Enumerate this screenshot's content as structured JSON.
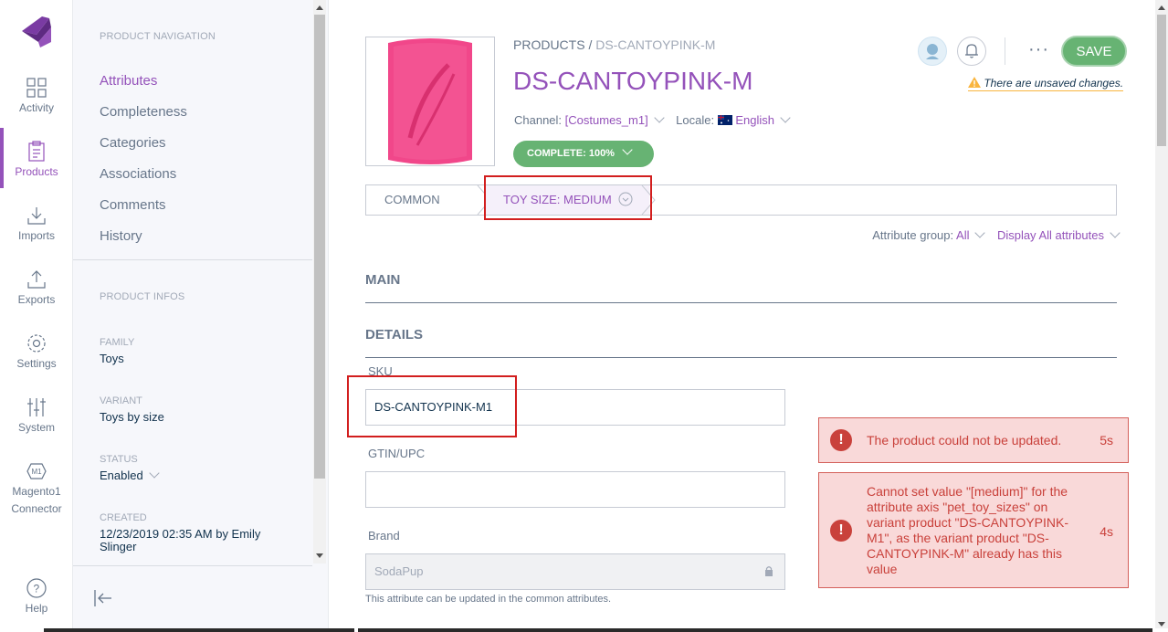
{
  "main_nav": {
    "items": [
      {
        "label": "Activity",
        "icon": "dashboard-grid-icon",
        "active": false
      },
      {
        "label": "Products",
        "icon": "clipboard-icon",
        "active": true
      },
      {
        "label": "Imports",
        "icon": "import-icon",
        "active": false
      },
      {
        "label": "Exports",
        "icon": "export-icon",
        "active": false
      },
      {
        "label": "Settings",
        "icon": "gear-icon",
        "active": false
      },
      {
        "label": "System",
        "icon": "sliders-icon",
        "active": false
      },
      {
        "label": "Magento1",
        "label2": "Connector",
        "icon": "magento-connector-icon",
        "active": false
      }
    ],
    "help": {
      "label": "Help",
      "icon": "help-icon"
    }
  },
  "sub_nav": {
    "nav_title": "PRODUCT NAVIGATION",
    "links": [
      {
        "label": "Attributes",
        "active": true
      },
      {
        "label": "Completeness",
        "active": false
      },
      {
        "label": "Categories",
        "active": false
      },
      {
        "label": "Associations",
        "active": false
      },
      {
        "label": "Comments",
        "active": false
      },
      {
        "label": "History",
        "active": false
      }
    ],
    "infos_title": "PRODUCT INFOS",
    "family_label": "FAMILY",
    "family_value": "Toys",
    "variant_label": "VARIANT",
    "variant_value": "Toys by size",
    "status_label": "STATUS",
    "status_value": "Enabled",
    "created_label": "CREATED",
    "created_value": "12/23/2019 02:35 AM by Emily Slinger"
  },
  "header": {
    "breadcrumb_root": "PRODUCTS",
    "breadcrumb_sep": "/",
    "breadcrumb_current": "DS-CANTOYPINK-M",
    "title": "DS-CANTOYPINK-M",
    "channel_label": "Channel:",
    "channel_value": "[Costumes_m1]",
    "locale_label": "Locale:",
    "locale_value": "English",
    "completeness": "COMPLETE: 100%",
    "save_label": "SAVE",
    "more_label": "···",
    "unsaved": "There are unsaved changes."
  },
  "tabs": {
    "common": "COMMON",
    "toy_size": "TOY SIZE: Medium"
  },
  "filters": {
    "group_label": "Attribute group:",
    "group_value": "All",
    "display_value": "Display All attributes"
  },
  "sections": {
    "main": "MAIN",
    "details": "DETAILS"
  },
  "fields": {
    "sku_label": "SKU",
    "sku_value": "DS-CANTOYPINK-M1",
    "gtin_label": "GTIN/UPC",
    "gtin_value": "",
    "brand_label": "Brand",
    "brand_value": "SodaPup",
    "brand_hint": "This attribute can be updated in the common attributes."
  },
  "notifications": [
    {
      "message": "The product could not be updated.",
      "time": "5s"
    },
    {
      "message": "Cannot set value \"[medium]\" for the attribute axis \"pet_toy_sizes\" on variant product \"DS-CANTOYPINK-M1\", as the variant product \"DS-CANTOYPINK-M\" already has this value",
      "time": "4s"
    }
  ],
  "colors": {
    "accent": "#9452ba",
    "success": "#67b373",
    "error": "#c9413b",
    "highlight_box": "#d21e1e"
  }
}
